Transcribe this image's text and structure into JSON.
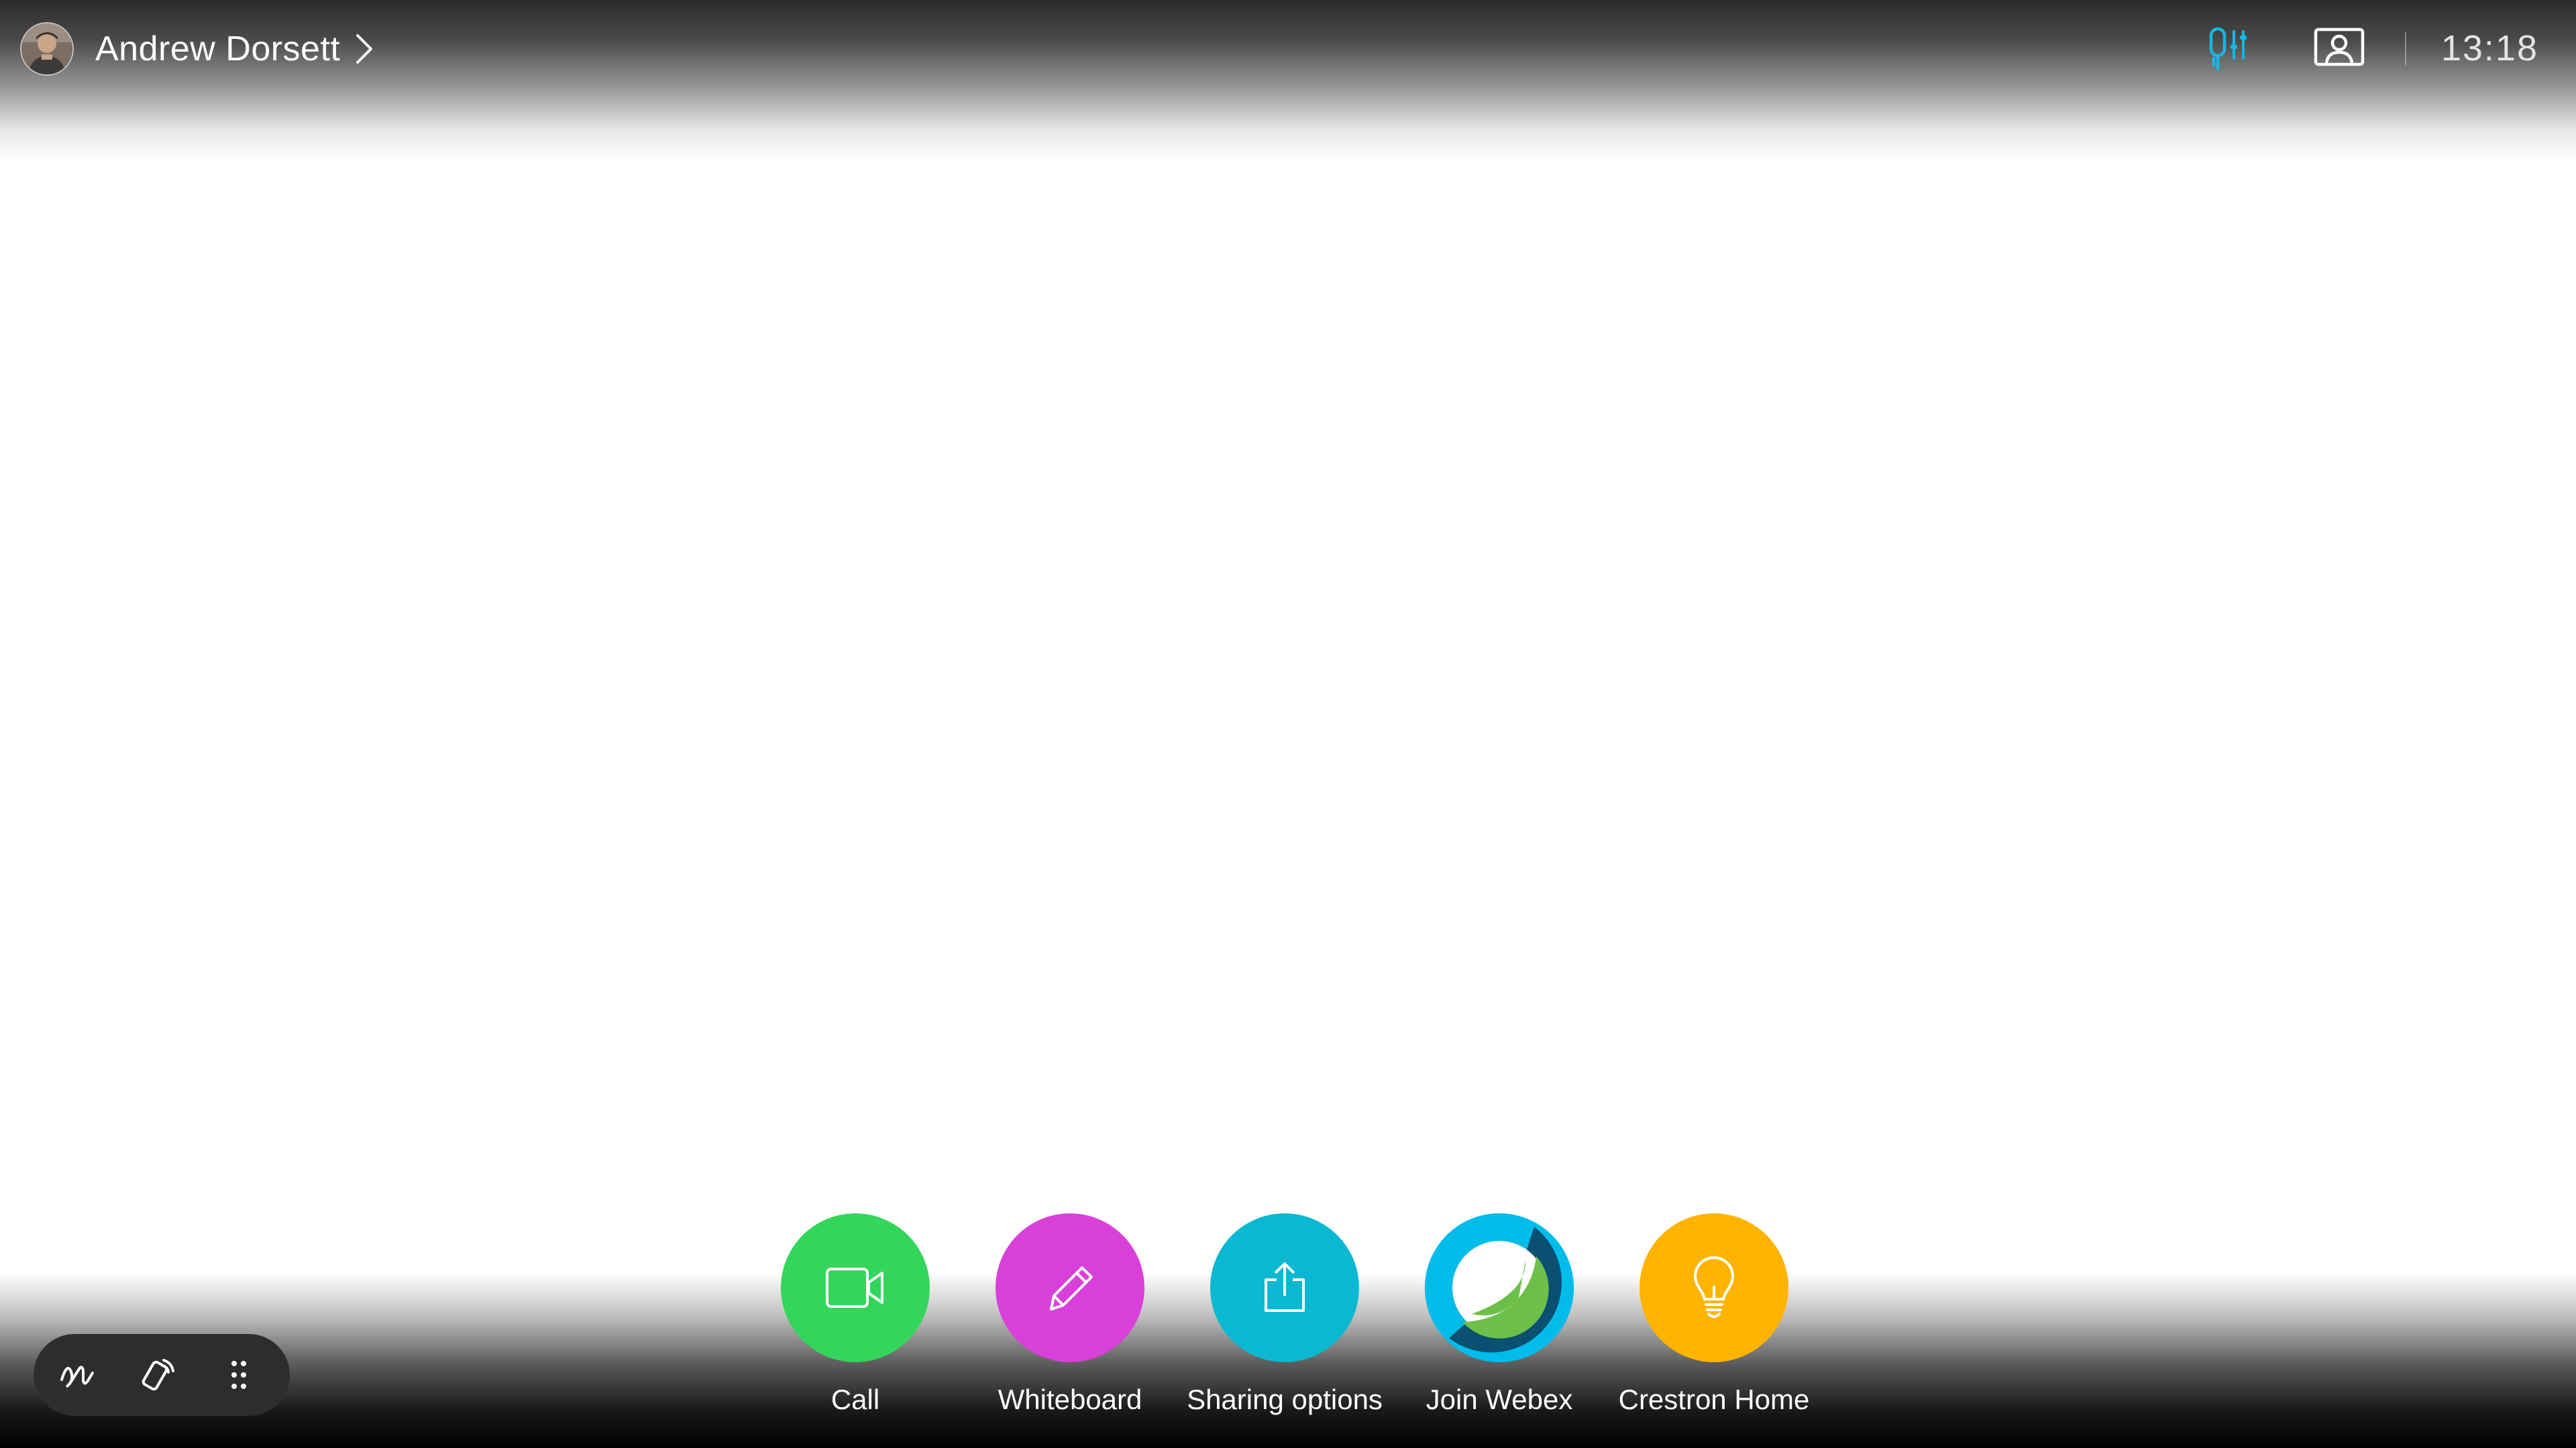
{
  "header": {
    "user_name": "Andrew Dorsett",
    "avatar_icon": "user-photo-avatar",
    "clock": "13:18",
    "mic_settings_icon": "mic-settings-icon",
    "self_view_icon": "self-view-icon",
    "accent_color": "#14b8e6"
  },
  "launcher": {
    "apps": [
      {
        "label": "Call",
        "icon": "video-camera-icon",
        "color": "#33d65a"
      },
      {
        "label": "Whiteboard",
        "icon": "pencil-icon",
        "color": "#d940d9"
      },
      {
        "label": "Sharing options",
        "icon": "share-upload-icon",
        "color": "#0ab8d2"
      },
      {
        "label": "Join Webex",
        "icon": "webex-logo-icon",
        "color": "#00bceb"
      },
      {
        "label": "Crestron Home",
        "icon": "lightbulb-icon",
        "color": "#ffb400"
      }
    ]
  },
  "toolbar": {
    "items": [
      {
        "icon": "annotate-scribble-icon"
      },
      {
        "icon": "proximity-pairing-icon"
      },
      {
        "icon": "more-dots-icon"
      }
    ],
    "background": "#2d2d2d"
  }
}
